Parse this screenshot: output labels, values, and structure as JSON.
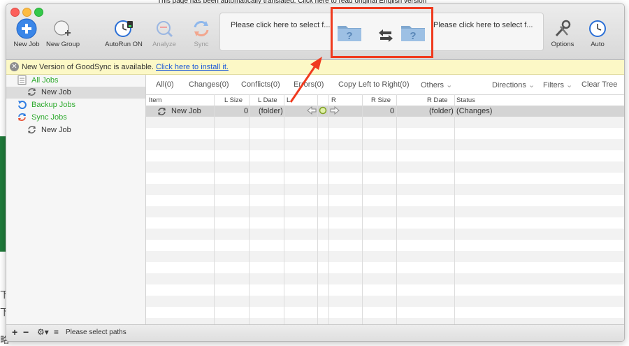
{
  "background": {
    "cjk_chars": [
      "下",
      "下",
      "略"
    ],
    "top_text": "This page has been automatically translated. Click here to read original English version"
  },
  "toolbar": {
    "new_job": "New Job",
    "new_group": "New Group",
    "autorun": "AutoRun ON",
    "analyze": "Analyze",
    "sync": "Sync",
    "options": "Options",
    "auto": "Auto",
    "left_path_placeholder": "Please click here to select f...",
    "right_path_placeholder": "Please click here to select f..."
  },
  "notice": {
    "message": "New Version of GoodSync is available.",
    "link": "Click here to install it."
  },
  "sidebar": {
    "all_jobs": "All Jobs",
    "all_jobs_child": "New Job",
    "backup_jobs": "Backup Jobs",
    "sync_jobs": "Sync Jobs",
    "sync_jobs_child": "New Job"
  },
  "filters": {
    "all": "All(0)",
    "changes": "Changes(0)",
    "conflicts": "Conflicts(0)",
    "errors": "Errors(0)",
    "copy_lr": "Copy Left to Right(0)",
    "others": "Others",
    "directions": "Directions",
    "filters": "Filters",
    "clear_tree": "Clear Tree"
  },
  "columns": {
    "item": "Item",
    "l_size": "L Size",
    "l_date": "L Date",
    "l": "L",
    "r": "R",
    "r_size": "R Size",
    "r_date": "R Date",
    "status": "Status"
  },
  "rows": [
    {
      "item": "New Job",
      "l_size": "0",
      "l_date": "(folder)",
      "r_size": "0",
      "r_date": "(folder)",
      "status": "(Changes)"
    }
  ],
  "statusbar": {
    "message": "Please select paths"
  },
  "colors": {
    "accent_blue": "#2f7de1",
    "green_text": "#2eaa2e",
    "red_highlight": "#f03a1e",
    "notice_bg": "#fcf8c6"
  }
}
